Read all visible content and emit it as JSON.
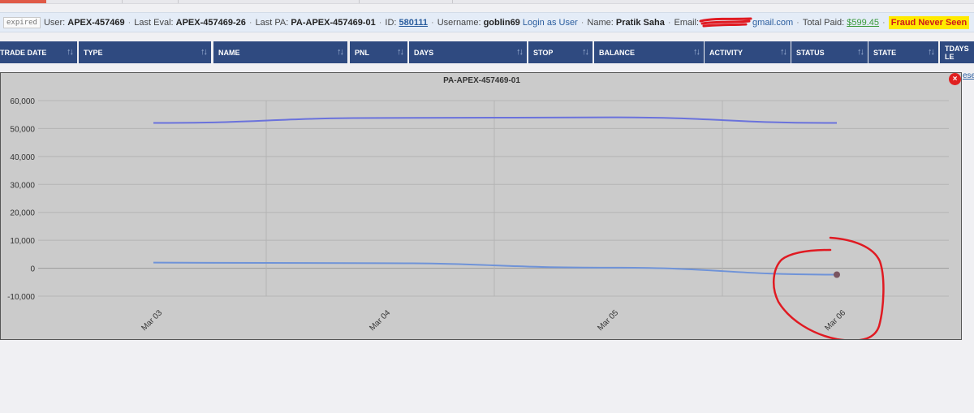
{
  "info_bar": {
    "status_badge": "expired",
    "user_label": "User:",
    "user_value": "APEX-457469",
    "last_eval_label": "Last Eval:",
    "last_eval_value": "APEX-457469-26",
    "last_pa_label": "Last PA:",
    "last_pa_value": "PA-APEX-457469-01",
    "id_label": "ID:",
    "id_value": "580111",
    "username_label": "Username:",
    "username_value": "goblin69",
    "login_as_user": "Login as User",
    "name_label": "Name:",
    "name_value": "Pratik Saha",
    "email_label": "Email:",
    "email_visible": "gmail.com",
    "total_paid_label": "Total Paid:",
    "total_paid_value": "$599.45",
    "fraud_badge": "Fraud Never Seen",
    "separator": "·"
  },
  "table_headers": [
    "TRADE DATE",
    "TYPE",
    "NAME",
    "PNL",
    "DAYS",
    "STOP",
    "BALANCE",
    "ACTIVITY",
    "STATUS",
    "STATE",
    "TDAYS LE"
  ],
  "reset_link": "eset",
  "close_icon": "×",
  "colors": {
    "header_bg": "#2f4a80",
    "fraud_bg": "#ffea00",
    "fraud_text": "#d0181a",
    "balance_line": "#6a72dc",
    "pnl_line": "#6f93d8",
    "annotation": "#e01a22",
    "panel_bg": "#cbcbcb"
  },
  "chart_data": {
    "type": "line",
    "title": "PA-APEX-457469-01",
    "categories": [
      "Mar 03",
      "Mar 04",
      "Mar 05",
      "Mar 06"
    ],
    "yticks": [
      "60,000",
      "50,000",
      "40,000",
      "30,000",
      "20,000",
      "10,000",
      "0",
      "-10,000"
    ],
    "ylim": [
      -10000,
      60000
    ],
    "series": [
      {
        "values": [
          52000,
          53800,
          54000,
          52000
        ]
      },
      {
        "values": [
          2000,
          1800,
          200,
          -2300
        ]
      }
    ],
    "grid": true,
    "highlighted_point": {
      "category": "Mar 06",
      "value": -2300
    }
  }
}
